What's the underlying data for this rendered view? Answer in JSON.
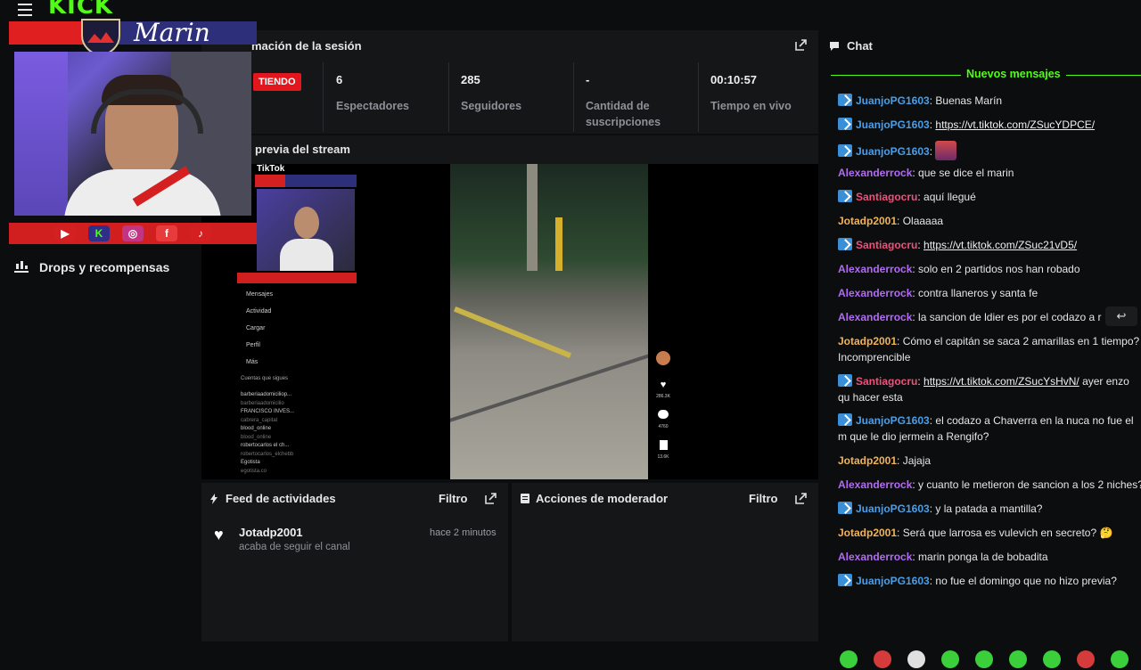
{
  "brand": {
    "logo_text": "KICK",
    "accent": "#53fc18"
  },
  "overlay": {
    "name": "Marin",
    "social_icons": [
      "youtube-icon",
      "kick-icon",
      "instagram-icon",
      "facebook-icon",
      "tiktok-icon"
    ]
  },
  "sidebar": {
    "drops_label": "Drops y recompensas"
  },
  "session": {
    "title": "mación de la sesión",
    "live_label": "TIENDO",
    "stats": [
      {
        "value": "6",
        "label": "Espectadores"
      },
      {
        "value": "285",
        "label": "Seguidores"
      },
      {
        "value": "-",
        "label": "Cantidad de suscripciones"
      },
      {
        "value": "00:10:57",
        "label": "Tiempo en vivo"
      }
    ]
  },
  "preview": {
    "title": "previa del stream",
    "tiktok": {
      "logo": "TikTok",
      "menu": [
        "Mensajes",
        "Actividad",
        "Cargar",
        "Perfil",
        "Más"
      ],
      "following_header": "Cuentas que sigues",
      "following": [
        {
          "name": "barberiaadomiciliop...",
          "sub": "barberiaadomicilio"
        },
        {
          "name": "FRANCISCO INVES...",
          "sub": "cabrera_capital"
        },
        {
          "name": "blood_online",
          "sub": "blood_online"
        },
        {
          "name": "robertocarlos el ch...",
          "sub": "robertocarlos_elchebb"
        },
        {
          "name": "Egotista",
          "sub": "egotista.co"
        }
      ],
      "side_counts": [
        "286.3K",
        "4760",
        "13.6K"
      ]
    }
  },
  "feed": {
    "title": "Feed de actividades",
    "filter": "Filtro",
    "items": [
      {
        "user": "Jotadp2001",
        "action": "acaba de seguir el canal",
        "time": "hace 2 minutos"
      }
    ]
  },
  "mod": {
    "title": "Acciones de moderador",
    "filter": "Filtro"
  },
  "chat": {
    "title": "Chat",
    "new_messages": "Nuevos mensajes",
    "colors": {
      "blue": "#4a9fe8",
      "purple": "#b26bf2",
      "pink": "#f0507c",
      "orange": "#f2b356"
    },
    "messages": [
      {
        "user": "JuanjoPG1603",
        "sep": ": ",
        "text": "Buenas Marín",
        "color": "blue",
        "badge": true
      },
      {
        "user": "JuanjoPG1603",
        "sep": ": ",
        "text": "https://vt.tiktok.com/ZSucYDPCE/",
        "color": "blue",
        "badge": true,
        "link": true
      },
      {
        "user": "JuanjoPG1603",
        "sep": ": ",
        "text": "",
        "color": "blue",
        "badge": true,
        "emote": true
      },
      {
        "user": "Alexanderrock",
        "sep": ": ",
        "text": "que se dice el marin",
        "color": "purple"
      },
      {
        "user": "Santiagocru",
        "sep": ": ",
        "text": "aquí llegué",
        "color": "pink",
        "badge": true
      },
      {
        "user": "Jotadp2001",
        "sep": ": ",
        "text": "Olaaaaa",
        "color": "orange"
      },
      {
        "user": "Santiagocru",
        "sep": ": ",
        "text": "https://vt.tiktok.com/ZSuc21vD5/",
        "color": "pink",
        "badge": true,
        "link": true
      },
      {
        "user": "Alexanderrock",
        "sep": ": ",
        "text": "solo en 2 partidos nos han robado",
        "color": "purple"
      },
      {
        "user": "Alexanderrock",
        "sep": ": ",
        "text": "contra llaneros y santa fe",
        "color": "purple"
      },
      {
        "user": "Alexanderrock",
        "sep": ": ",
        "text": "la sancion de ldier es por el codazo a r",
        "color": "purple"
      },
      {
        "user": "Jotadp2001",
        "sep": ": ",
        "text": "Cómo el capitán se saca 2 amarillas en 1 tiempo? Incomprencible",
        "color": "orange"
      },
      {
        "user": "Santiagocru",
        "sep": ": ",
        "text": "https://vt.tiktok.com/ZSucYsHvN/",
        "extra": " ayer enzo qu hacer esta",
        "color": "pink",
        "badge": true,
        "link": true
      },
      {
        "user": "JuanjoPG1603",
        "sep": ": ",
        "text": "el codazo a Chaverra en la nuca no fue el m que le dio jermein a Rengifo?",
        "color": "blue",
        "badge": true
      },
      {
        "user": "Jotadp2001",
        "sep": ": ",
        "text": "Jajaja",
        "color": "orange"
      },
      {
        "user": "Alexanderrock",
        "sep": ": ",
        "text": "y cuanto le metieron de sancion a los 2 niches?",
        "color": "purple"
      },
      {
        "user": "JuanjoPG1603",
        "sep": ": ",
        "text": "y la patada a mantilla?",
        "color": "blue",
        "badge": true
      },
      {
        "user": "Jotadp2001",
        "sep": ": ",
        "text": "Será que larrosa es vulevich en secreto? 🤔",
        "color": "orange"
      },
      {
        "user": "Alexanderrock",
        "sep": ": ",
        "text": "marin ponga la de bobadita",
        "color": "purple"
      },
      {
        "user": "JuanjoPG1603",
        "sep": ": ",
        "text": "no fue el domingo que no hizo previa?",
        "color": "blue",
        "badge": true
      }
    ],
    "emotes": [
      "#3ccf3c",
      "#d63b3b",
      "#e0e0e0",
      "#3ccf3c",
      "#3ccf3c",
      "#3ccf3c",
      "#3ccf3c",
      "#d63b3b",
      "#3ccf3c"
    ]
  }
}
